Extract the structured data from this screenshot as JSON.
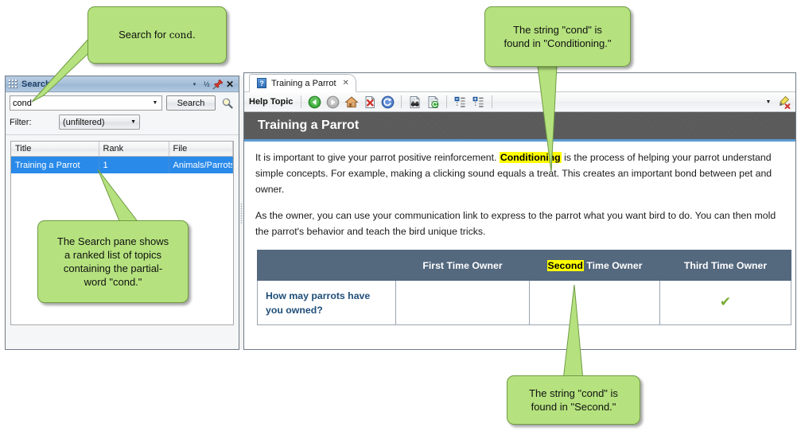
{
  "search_pane": {
    "title": "Search",
    "titlebar_buttons": [
      {
        "name": "pane-menu-caret",
        "glyph": "▾"
      },
      {
        "name": "auto-hide-half",
        "glyph": "½"
      },
      {
        "name": "pin",
        "glyph": "pin-icon"
      },
      {
        "name": "close",
        "glyph": "✕"
      }
    ],
    "query_value": "cond",
    "query_placeholder": "",
    "search_button_label": "Search",
    "magnifier_icon": "search-icon",
    "filter_label": "Filter:",
    "filter_value": "(unfiltered)",
    "columns": [
      "Title",
      "Rank",
      "File"
    ],
    "rows": [
      {
        "title": "Training a Parrot",
        "rank": "1",
        "file": "Animals/Parrots"
      }
    ]
  },
  "topic_window": {
    "tab": {
      "label": "Training a Parrot",
      "icon_glyph": "?",
      "close_glyph": "✕"
    },
    "toolbar": {
      "label": "Help Topic",
      "buttons": [
        {
          "name": "back-button",
          "icon": "back-arrow-icon"
        },
        {
          "name": "forward-button",
          "icon": "forward-arrow-icon"
        },
        {
          "name": "home-button",
          "icon": "home-icon"
        },
        {
          "name": "stop-button",
          "icon": "stop-page-icon"
        },
        {
          "name": "refresh-button",
          "icon": "refresh-icon"
        },
        {
          "name": "find-in-topic-button",
          "icon": "binoculars-page-icon"
        },
        {
          "name": "reload-topic-button",
          "icon": "reload-page-icon"
        },
        {
          "name": "collapse-all-button",
          "icon": "collapse-all-icon"
        },
        {
          "name": "expand-all-button",
          "icon": "expand-all-icon"
        },
        {
          "name": "highlight-dropdown",
          "icon": "chevron-down-icon"
        },
        {
          "name": "remove-highlight-button",
          "icon": "highlighter-remove-icon"
        }
      ]
    },
    "heading": "Training a Parrot",
    "paragraph1": {
      "before": "It is important to give your parrot positive reinforcement. ",
      "highlight": "Conditioning",
      "after": " is the process of helping your parrot understand simple concepts. For example, making a clicking sound equals a treat. This creates an important bond between pet and owner."
    },
    "paragraph2": "As the owner, you can use your communication link to express to the parrot what you want bird to do. You can then mold the parrot's behavior and teach the bird unique tricks.",
    "table": {
      "headers": [
        {
          "blank": true,
          "text": ""
        },
        {
          "blank": false,
          "text": "First Time Owner"
        },
        {
          "blank": false,
          "prefix_highlight": "Second",
          "text": " Time Owner"
        },
        {
          "blank": false,
          "text": "Third Time Owner"
        }
      ],
      "rows": [
        {
          "question": "How may parrots have you owned?",
          "first": "",
          "second": "",
          "third": "✔"
        }
      ]
    }
  },
  "callouts": {
    "top_left": {
      "text_plain": "Search for ",
      "text_mono": "cond."
    },
    "top_right_line1": "The string \"cond\" is",
    "top_right_line2": "found in \"Conditioning.\"",
    "bottom_left_line1": "The Search pane shows",
    "bottom_left_line2": "a ranked list of topics",
    "bottom_left_line3": "containing the partial-",
    "bottom_left_line4": "word \"cond.\"",
    "bottom_right_line1": "The string \"cond\" is",
    "bottom_right_line2": "found in \"Second.\""
  },
  "colors": {
    "callout_fill": "#b5e27e",
    "callout_border": "#6f9b43",
    "highlight_yellow": "#ffff00",
    "table_header": "#54687e",
    "banner_gray": "#595959",
    "banner_accent": "#5b9bd5",
    "selection_blue": "#2a8aea",
    "link_blue": "#1f4e79"
  }
}
